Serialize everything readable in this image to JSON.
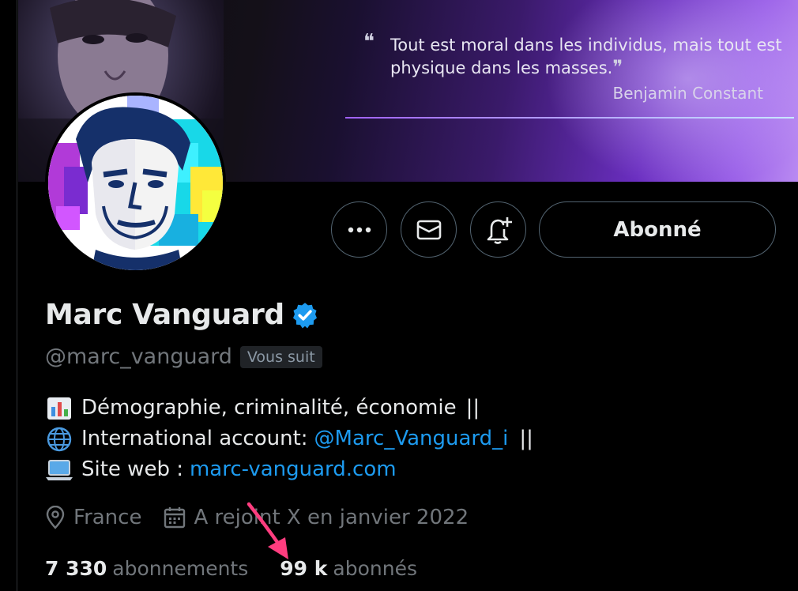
{
  "banner": {
    "quote_text": "Tout est moral dans les individus, mais tout est physique dans les masses.",
    "quote_author": "Benjamin Constant",
    "accent_color": "#9b5cf0"
  },
  "actions": {
    "more_icon": "more-horizontal-icon",
    "message_icon": "envelope-icon",
    "notify_icon": "bell-plus-icon",
    "follow_label": "Abonné"
  },
  "profile": {
    "display_name": "Marc Vanguard",
    "verified_color": "#1d9bf0",
    "handle": "@marc_vanguard",
    "follows_you": "Vous suit"
  },
  "bio": {
    "line1_text": "Démographie, criminalité, économie",
    "line1_suffix": "||",
    "line2_text": "International account:",
    "line2_link": "@Marc_Vanguard_i",
    "line2_suffix": "||",
    "line3_text": "Site web :",
    "line3_link": "marc-vanguard.com"
  },
  "meta": {
    "location": "France",
    "joined": "A rejoint X en janvier 2022"
  },
  "stats": {
    "following_count": "7 330",
    "following_label": "abonnements",
    "followers_count": "99 k",
    "followers_label": "abonnés"
  },
  "annotation": {
    "arrow_color": "#ff3d7f"
  }
}
